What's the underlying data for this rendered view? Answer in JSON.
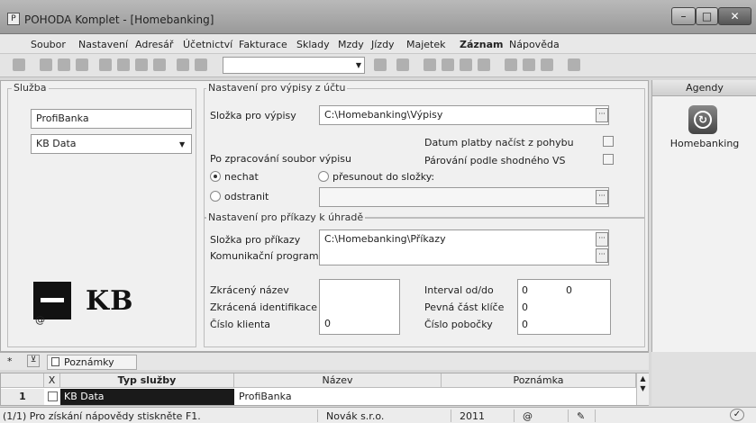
{
  "window": {
    "title": "POHODA Komplet - [Homebanking]",
    "app_icon": "pohoda-app-icon",
    "minimize": "–",
    "maximize": "□",
    "close": "✕"
  },
  "menu": [
    "Soubor",
    "Nastavení",
    "Adresář",
    "Účetnictví",
    "Fakturace",
    "Sklady",
    "Mzdy",
    "Jízdy",
    "Majetek",
    "Záznam",
    "Nápověda"
  ],
  "toolbar": {
    "combo_value": ""
  },
  "sluzba": {
    "label": "Služba",
    "name_value": "ProfiBanka",
    "bank_select": "KB Data",
    "logo_text": "KB",
    "at_symbol": "@"
  },
  "vypisy": {
    "group_label": "Nastavení pro výpisy z účtu",
    "folder_label": "Složka pro výpisy",
    "folder_value": "C:\\Homebanking\\Výpisy",
    "datum_label": "Datum platby načíst z pohybu",
    "parovani_label": "Párování podle shodného VS",
    "po_zpracovani_label": "Po zpracování soubor výpisu",
    "radio_keep": "nechat",
    "radio_move": "přesunout do složky:",
    "radio_delete": "odstranit",
    "move_folder_value": ""
  },
  "prikazy": {
    "group_label": "Nastavení pro příkazy k úhradě",
    "folder_label": "Složka pro příkazy",
    "program_label": "Komunikační program",
    "folder_value": "C:\\Homebanking\\Příkazy",
    "short_name_label": "Zkrácený název",
    "short_id_label": "Zkrácená identifikace",
    "client_no_label": "Číslo klienta",
    "client_no_value": "0",
    "interval_label": "Interval od/do",
    "interval_from": "0",
    "interval_to": "0",
    "key_label": "Pevná část klíče",
    "key_value": "0",
    "branch_label": "Číslo pobočky",
    "branch_value": "0"
  },
  "agendy": {
    "header": "Agendy",
    "item_label": "Homebanking",
    "item_icon": "homebanking-icon"
  },
  "bottom_tabs": {
    "star": "*",
    "notes": "Poznámky"
  },
  "table": {
    "headers": [
      "X",
      "Typ služby",
      "Název",
      "Poznámka"
    ],
    "rows": [
      {
        "num": "1",
        "typ": "KB Data",
        "nazev": "ProfiBanka",
        "poznamka": ""
      }
    ]
  },
  "status": {
    "help": "(1/1) Pro získání nápovědy stiskněte F1.",
    "company": "Novák s.r.o.",
    "year": "2011",
    "at": "@",
    "pen": "✎",
    "ok": "✓"
  }
}
